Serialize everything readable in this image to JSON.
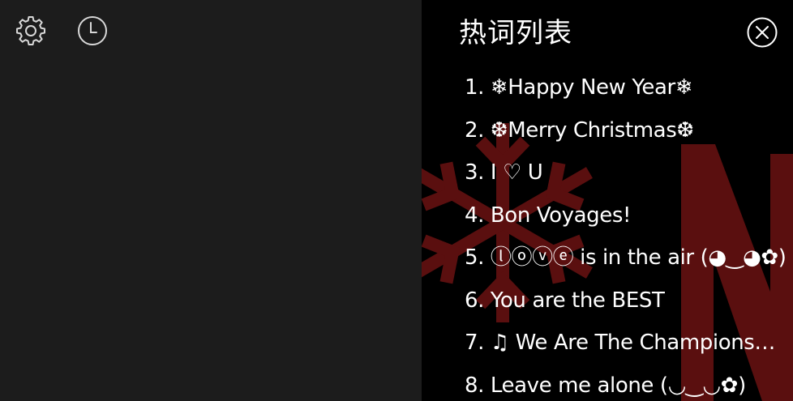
{
  "toolbar": {
    "settings_icon": "gear-icon",
    "history_icon": "clock-icon"
  },
  "panel": {
    "title": "热词列表",
    "close_icon": "close-circle-icon",
    "background_deco_color": "#5a0f0f",
    "items": [
      "1. ❄Happy New Year❄",
      "2. ❆Merry Christmas❆",
      "3. I ♡ U",
      "4. Bon Voyages!",
      "5. ⓛⓞⓥⓔ is in the air (◕‿◕✿)",
      "6. You are the BEST",
      "7. ♫ We Are The Champions…",
      "8. Leave me alone (◡‿◡✿)"
    ]
  },
  "colors": {
    "left_background": "#1c1c1c",
    "panel_background": "#000000",
    "text": "#ffffff"
  }
}
